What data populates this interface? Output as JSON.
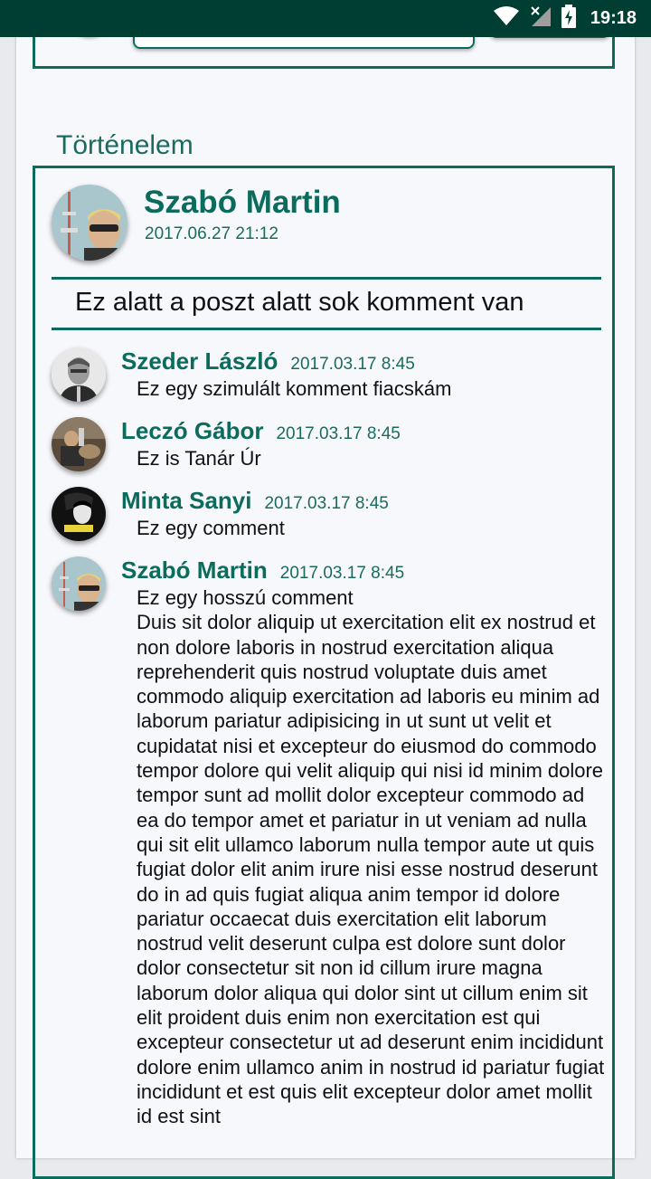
{
  "status_bar": {
    "time": "19:18",
    "icons": [
      "wifi-icon",
      "signal-off-icon",
      "battery-charging-icon"
    ]
  },
  "colors": {
    "accent": "#0b6b5c",
    "status_bar": "#003d33",
    "page_bg": "#f7f8fc"
  },
  "history": {
    "title": "Történelem",
    "post": {
      "author": "Szabó Martin",
      "date": "2017.06.27 21:12",
      "text": "Ez alatt a poszt alatt sok komment van"
    },
    "comments": [
      {
        "author": "Szeder László",
        "date": "2017.03.17 8:45",
        "text": "Ez egy szimulált komment fiacskám"
      },
      {
        "author": "Leczó Gábor",
        "date": "2017.03.17 8:45",
        "text": "Ez is Tanár Úr"
      },
      {
        "author": "Minta Sanyi",
        "date": "2017.03.17 8:45",
        "text": "Ez egy comment"
      },
      {
        "author": "Szabó Martin",
        "date": "2017.03.17 8:45",
        "text": "Ez egy hosszú comment\nDuis sit dolor aliquip ut exercitation elit ex nostrud et non dolore laboris in nostrud exercitation aliqua reprehenderit quis nostrud voluptate duis amet commodo aliquip exercitation ad laboris eu minim ad laborum pariatur adipisicing in ut sunt ut velit et cupidatat nisi et excepteur do eiusmod do commodo tempor dolore qui velit aliquip qui nisi id minim dolore tempor sunt ad mollit dolor excepteur commodo ad ea do tempor amet et pariatur in ut veniam ad nulla qui sit elit ullamco laborum nulla tempor aute ut quis fugiat dolor elit anim irure nisi esse nostrud deserunt do in ad quis fugiat aliqua anim tempor id dolore pariatur occaecat duis exercitation elit laborum nostrud velit deserunt culpa est dolore sunt dolor dolor consectetur sit non id cillum irure magna laborum dolor aliqua qui dolor sint ut cillum enim sit elit proident duis enim non exercitation est qui excepteur consectetur ut ad deserunt enim incididunt dolore enim ullamco anim in nostrud id pariatur fugiat incididunt et est quis elit excepteur dolor amet mollit id est sint"
      }
    ]
  }
}
